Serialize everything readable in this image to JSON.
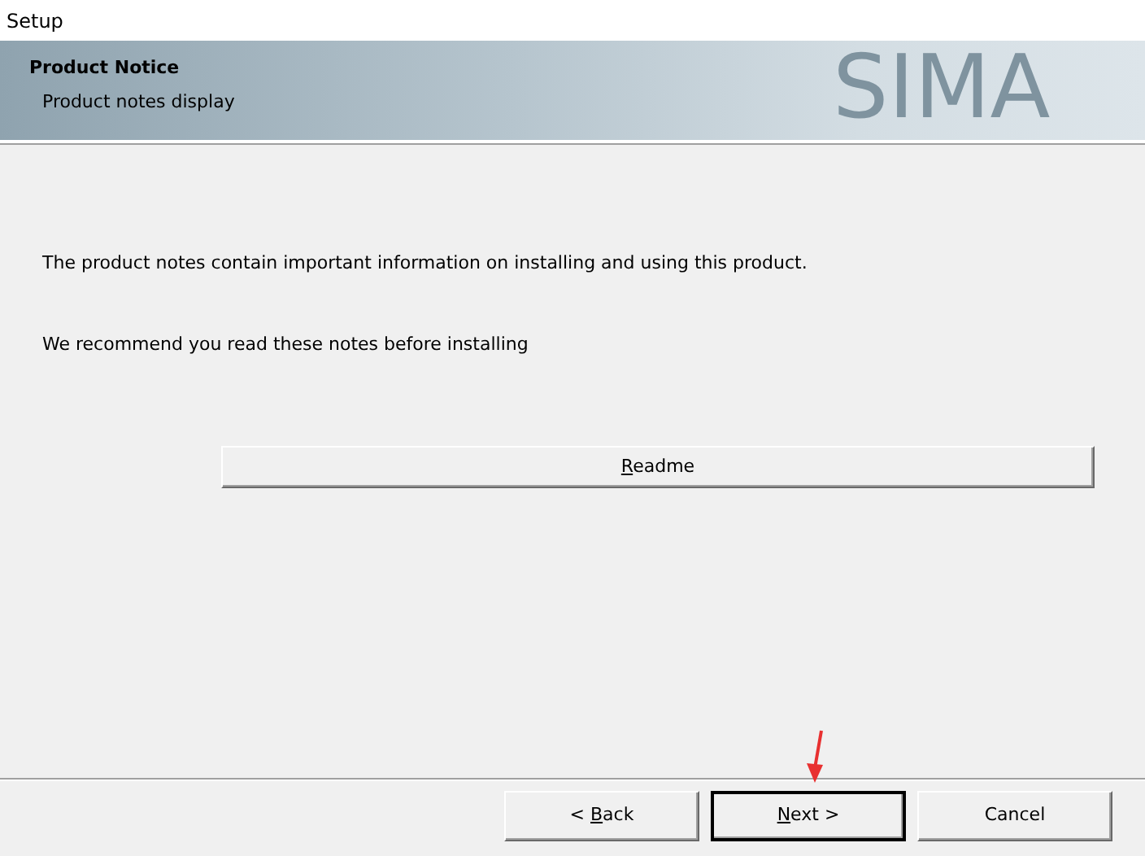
{
  "window": {
    "title": "Setup"
  },
  "header": {
    "title": "Product Notice",
    "subtitle": "Product notes display",
    "banner_text": "SIMA"
  },
  "body": {
    "paragraphs": [
      "The product notes contain important information on installing and using this product.",
      "We recommend you read these notes before installing"
    ],
    "readme_button": {
      "key": "R",
      "after": "eadme"
    }
  },
  "buttons": [
    {
      "before": "< ",
      "key": "B",
      "after": "ack",
      "default": false
    },
    {
      "key": "N",
      "after": "ext >",
      "default": true
    },
    {
      "after": "Cancel",
      "default": false
    }
  ]
}
